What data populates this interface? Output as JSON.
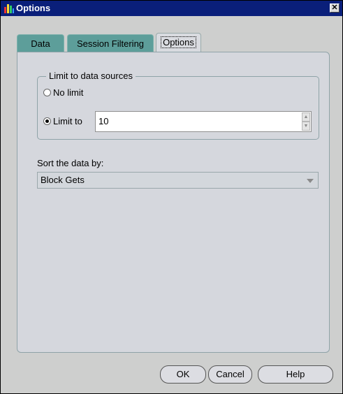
{
  "window": {
    "title": "Options",
    "close_glyph": "✕"
  },
  "tabs": [
    {
      "label": "Data",
      "active": false
    },
    {
      "label": "Session Filtering",
      "active": false
    },
    {
      "label": "Options",
      "active": true
    }
  ],
  "limit_group": {
    "legend": "Limit to data sources",
    "options": [
      {
        "label": "No limit",
        "checked": false
      },
      {
        "label": "Limit to",
        "checked": true
      }
    ],
    "limit_value": "10"
  },
  "sort": {
    "label": "Sort the data by:",
    "selected": "Block Gets"
  },
  "buttons": {
    "ok": "OK",
    "cancel": "Cancel",
    "help": "Help"
  },
  "colors": {
    "titlebar": "#0a1f7a",
    "tab_inactive": "#5d9e9a",
    "panel": "#d5d7dd"
  },
  "icons": {
    "app": "chart-bars-icon",
    "close": "close-icon",
    "spin_up": "triangle-up-icon",
    "spin_down": "triangle-down-icon",
    "dropdown": "chevron-down-icon"
  }
}
